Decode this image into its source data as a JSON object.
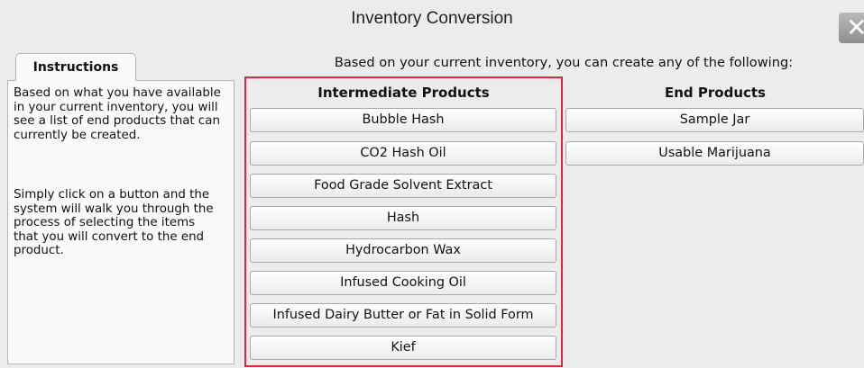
{
  "window": {
    "title": "Inventory Conversion"
  },
  "close_glyph": "✕",
  "instructions": {
    "tab_label": "Instructions",
    "para1": "Based on what you have available in your current inventory, you will see a list of end products that can currently be created.",
    "para2": "Simply click on a button and the system will walk you through the process of selecting the items that you will convert to the end product."
  },
  "main": {
    "subtitle": "Based on your current inventory, you can create any of the following:",
    "intermediate": {
      "heading": "Intermediate Products",
      "items": [
        "Bubble Hash",
        "CO2 Hash Oil",
        "Food Grade Solvent Extract",
        "Hash",
        "Hydrocarbon Wax",
        "Infused Cooking Oil",
        "Infused Dairy Butter or Fat in Solid Form",
        "Kief"
      ]
    },
    "end": {
      "heading": "End Products",
      "items": [
        "Sample Jar",
        "Usable Marijuana"
      ]
    }
  },
  "colors": {
    "highlight": "#e0263f",
    "background": "#ececec",
    "panel": "#fafafa"
  }
}
